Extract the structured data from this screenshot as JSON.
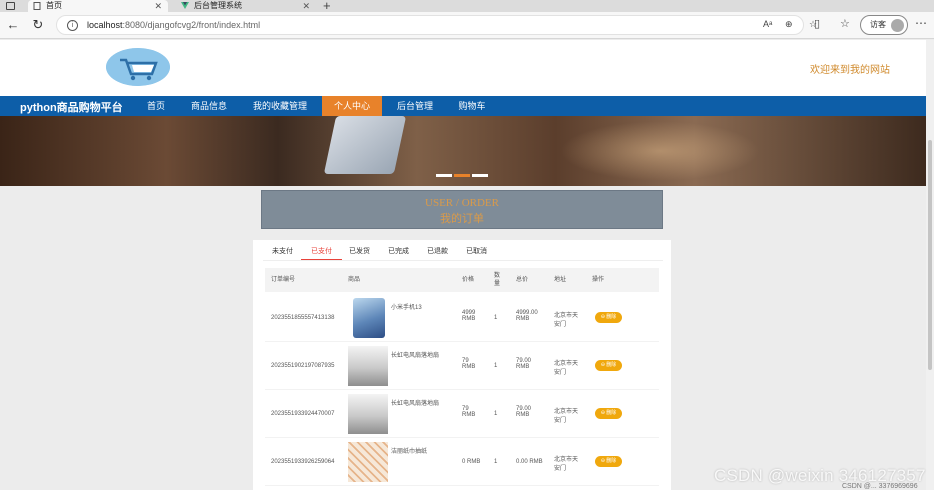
{
  "browser": {
    "tabs": [
      {
        "label": "首页",
        "close": "✕"
      },
      {
        "label": "后台管理系统",
        "close": "✕"
      }
    ],
    "url_host": "localhost",
    "url_path": ":8080/djangofcvg2/front/index.html",
    "guest_label": "访客"
  },
  "site": {
    "welcome": "欢迎来到我的网站",
    "brand": "python商品购物平台",
    "nav": [
      "首页",
      "商品信息",
      "我的收藏管理",
      "个人中心",
      "后台管理",
      "购物车"
    ],
    "active_nav": "个人中心"
  },
  "order_banner": {
    "en": "USER / ORDER",
    "cn": "我的订单"
  },
  "order_tabs": [
    "未支付",
    "已支付",
    "已发货",
    "已完成",
    "已退款",
    "已取消"
  ],
  "active_order_tab": "已支付",
  "table": {
    "headers": [
      "订单编号",
      "商品",
      "价格",
      "数量",
      "总价",
      "地址",
      "操作"
    ],
    "rows": [
      {
        "order_no": "2023551855557413138",
        "product": "小米手机13",
        "price_line1": "4999",
        "price_line2": "RMB",
        "qty": "1",
        "total_line1": "4999.00",
        "total_line2": "RMB",
        "addr_line1": "北京市天",
        "addr_line2": "安门",
        "action": "删除",
        "thumb": "phone"
      },
      {
        "order_no": "2023551902197087935",
        "product": "长虹电风扇落地扇",
        "price_line1": "79",
        "price_line2": "RMB",
        "qty": "1",
        "total_line1": "79.00",
        "total_line2": "RMB",
        "addr_line1": "北京市天",
        "addr_line2": "安门",
        "action": "删除",
        "thumb": "fan"
      },
      {
        "order_no": "2023551933924470007",
        "product": "长虹电风扇落地扇",
        "price_line1": "79",
        "price_line2": "RMB",
        "qty": "1",
        "total_line1": "79.00",
        "total_line2": "RMB",
        "addr_line1": "北京市天",
        "addr_line2": "安门",
        "action": "删除",
        "thumb": "fan"
      },
      {
        "order_no": "2023551933926259064",
        "product": "洁丽纸巾抽纸",
        "price_line1": "0 RMB",
        "price_line2": "",
        "qty": "1",
        "total_line1": "0.00 RMB",
        "total_line2": "",
        "addr_line1": "北京市天",
        "addr_line2": "安门",
        "action": "删除",
        "thumb": "towel"
      }
    ]
  },
  "watermark": "CSDN @weixin 346127357",
  "watermark_small": "CSDN @... 3376969696",
  "colors": {
    "nav_blue": "#0d5ea8",
    "nav_active": "#e8822a",
    "accent_orange": "#d99a4a",
    "delete_btn": "#f0a80d",
    "active_tab_red": "#e8423a"
  }
}
